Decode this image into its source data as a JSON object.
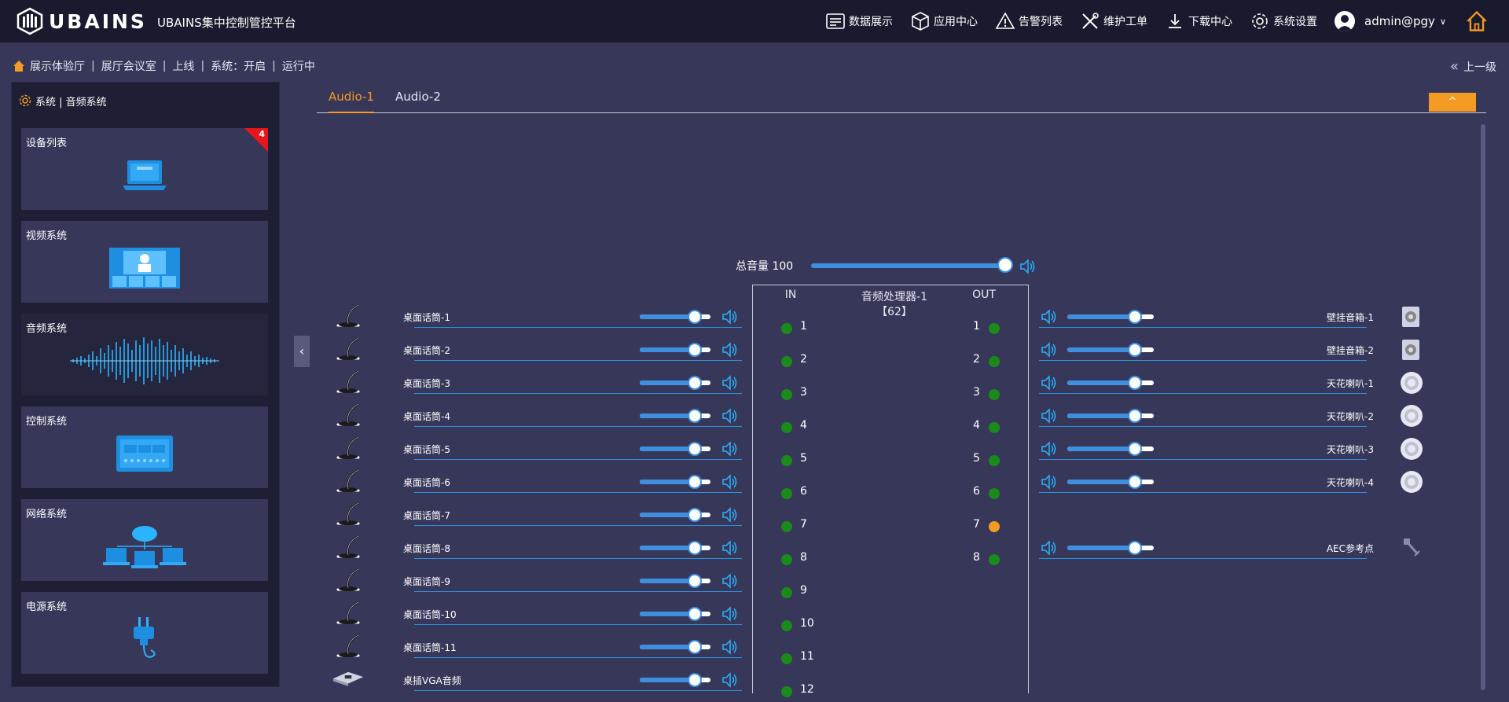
{
  "header": {
    "brand": "UBAINS",
    "platform_title": "UBAINS集中控制管控平台",
    "nav": [
      {
        "label": "数据展示",
        "icon": "data-display-icon"
      },
      {
        "label": "应用中心",
        "icon": "app-center-cube-icon"
      },
      {
        "label": "告警列表",
        "icon": "alarm-warning-icon"
      },
      {
        "label": "维护工单",
        "icon": "maintenance-tools-icon"
      },
      {
        "label": "下载中心",
        "icon": "download-icon"
      },
      {
        "label": "系统设置",
        "icon": "gear-icon"
      }
    ],
    "user": "admin@pgy"
  },
  "breadcrumb": {
    "items": [
      "展示体验厅",
      "展厅会议室",
      "上线",
      "系统：开启",
      "运行中"
    ],
    "back_label": "上一级"
  },
  "sidebar": {
    "header": "系统 | 音频系统",
    "cards": [
      {
        "title": "设备列表",
        "badge": "4",
        "icon": "laptop-icon"
      },
      {
        "title": "视频系统",
        "icon": "video-conference-icon"
      },
      {
        "title": "音频系统",
        "icon": "sound-wave-icon"
      },
      {
        "title": "控制系统",
        "icon": "control-panel-icon"
      },
      {
        "title": "网络系统",
        "icon": "network-cloud-icon"
      },
      {
        "title": "电源系统",
        "icon": "power-plug-icon"
      }
    ]
  },
  "tabs": [
    {
      "label": "Audio-1",
      "active": true
    },
    {
      "label": "Audio-2",
      "active": false
    }
  ],
  "collapse_label": "^",
  "master": {
    "label": "总音量 100",
    "volume": 100
  },
  "processor": {
    "in_label": "IN",
    "out_label": "OUT",
    "name": "音频处理器-1",
    "id": "【62】",
    "in_channels": [
      {
        "num": "1",
        "status": "green"
      },
      {
        "num": "2",
        "status": "green"
      },
      {
        "num": "3",
        "status": "green"
      },
      {
        "num": "4",
        "status": "green"
      },
      {
        "num": "5",
        "status": "green"
      },
      {
        "num": "6",
        "status": "green"
      },
      {
        "num": "7",
        "status": "green"
      },
      {
        "num": "8",
        "status": "green"
      },
      {
        "num": "9",
        "status": "green"
      },
      {
        "num": "10",
        "status": "green"
      },
      {
        "num": "11",
        "status": "green"
      },
      {
        "num": "12",
        "status": "green"
      }
    ],
    "out_channels": [
      {
        "num": "1",
        "status": "green"
      },
      {
        "num": "2",
        "status": "green"
      },
      {
        "num": "3",
        "status": "green"
      },
      {
        "num": "4",
        "status": "green"
      },
      {
        "num": "5",
        "status": "green"
      },
      {
        "num": "6",
        "status": "green"
      },
      {
        "num": "7",
        "status": "orange"
      },
      {
        "num": "8",
        "status": "green"
      }
    ]
  },
  "inputs": [
    {
      "label": "桌面话筒-1",
      "level": 0.78,
      "device": "gooseneck-mic-icon"
    },
    {
      "label": "桌面话筒-2",
      "level": 0.78,
      "device": "gooseneck-mic-icon"
    },
    {
      "label": "桌面话筒-3",
      "level": 0.78,
      "device": "gooseneck-mic-icon"
    },
    {
      "label": "桌面话筒-4",
      "level": 0.78,
      "device": "gooseneck-mic-icon"
    },
    {
      "label": "桌面话筒-5",
      "level": 0.78,
      "device": "gooseneck-mic-icon"
    },
    {
      "label": "桌面话筒-6",
      "level": 0.78,
      "device": "gooseneck-mic-icon"
    },
    {
      "label": "桌面话筒-7",
      "level": 0.78,
      "device": "gooseneck-mic-icon"
    },
    {
      "label": "桌面话筒-8",
      "level": 0.78,
      "device": "gooseneck-mic-icon"
    },
    {
      "label": "桌面话筒-9",
      "level": 0.78,
      "device": "gooseneck-mic-icon"
    },
    {
      "label": "桌面话筒-10",
      "level": 0.78,
      "device": "gooseneck-mic-icon"
    },
    {
      "label": "桌面话筒-11",
      "level": 0.78,
      "device": "gooseneck-mic-icon"
    },
    {
      "label": "桌插VGA音频",
      "level": 0.78,
      "device": "table-socket-icon"
    }
  ],
  "outputs": [
    {
      "label": "壁挂音箱-1",
      "level": 0.78,
      "device": "wall-speaker-icon"
    },
    {
      "label": "壁挂音箱-2",
      "level": 0.78,
      "device": "wall-speaker-icon"
    },
    {
      "label": "天花喇叭-1",
      "level": 0.78,
      "device": "ceiling-speaker-icon"
    },
    {
      "label": "天花喇叭-2",
      "level": 0.78,
      "device": "ceiling-speaker-icon"
    },
    {
      "label": "天花喇叭-3",
      "level": 0.78,
      "device": "ceiling-speaker-icon"
    },
    {
      "label": "天花喇叭-4",
      "level": 0.78,
      "device": "ceiling-speaker-icon"
    },
    {
      "label": "AEC参考点",
      "level": 0.78,
      "device": "aec-reference-icon"
    }
  ],
  "colors": {
    "accent": "#f39b23",
    "slider": "#3e8fe0",
    "status_ok": "#1a8a1a",
    "status_warn": "#f39b23",
    "badge": "#e5171c",
    "background": "#37375a",
    "topbar": "#1a1a2e"
  }
}
